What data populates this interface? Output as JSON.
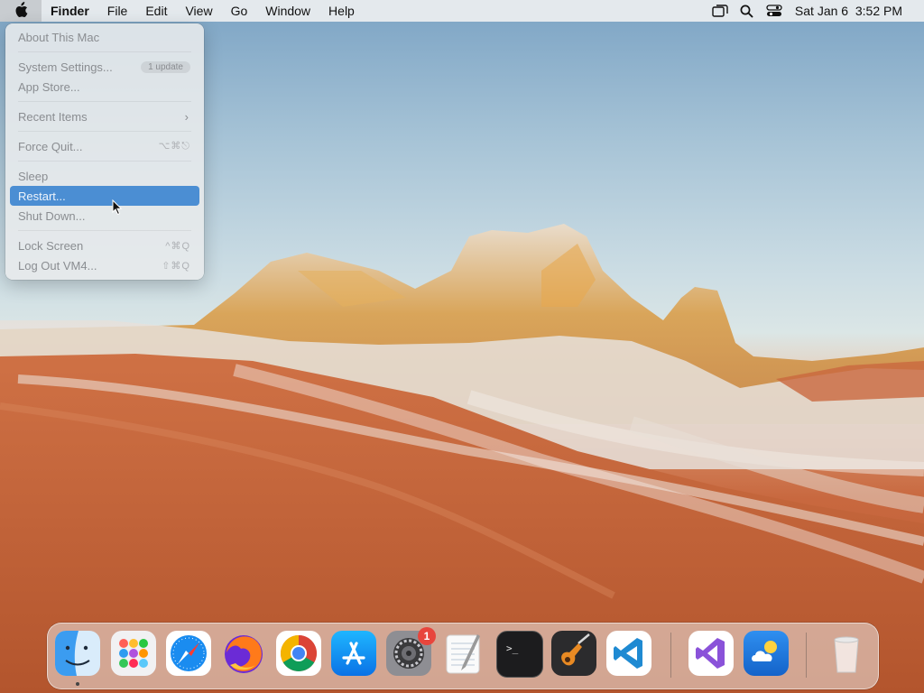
{
  "menubar": {
    "apple_icon": "apple-logo-icon",
    "items": [
      "Finder",
      "File",
      "Edit",
      "View",
      "Go",
      "Window",
      "Help"
    ],
    "status_icons": [
      "screen-mirroring-icon",
      "search-icon",
      "control-center-icon"
    ],
    "date": "Sat Jan 6",
    "time": "3:52 PM"
  },
  "apple_menu": {
    "about": "About This Mac",
    "system_settings": "System Settings...",
    "update_badge": "1 update",
    "app_store": "App Store...",
    "recent_items": "Recent Items",
    "force_quit": "Force Quit...",
    "force_quit_shortcut": "⌥⌘⎋",
    "sleep": "Sleep",
    "restart": "Restart...",
    "shut_down": "Shut Down...",
    "lock_screen": "Lock Screen",
    "lock_screen_shortcut": "^⌘Q",
    "log_out": "Log Out VM4...",
    "log_out_shortcut": "⇧⌘Q",
    "highlighted": "Restart..."
  },
  "dock": {
    "apps": [
      "finder",
      "launchpad",
      "safari",
      "firefox",
      "chrome",
      "app-store",
      "system-settings",
      "textedit",
      "terminal",
      "garageband",
      "vscode",
      "visual-studio",
      "weather"
    ],
    "trash": "trash",
    "settings_badge": "1"
  },
  "colors": {
    "highlight": "#4b8ed3",
    "badge": "#e8453c"
  }
}
